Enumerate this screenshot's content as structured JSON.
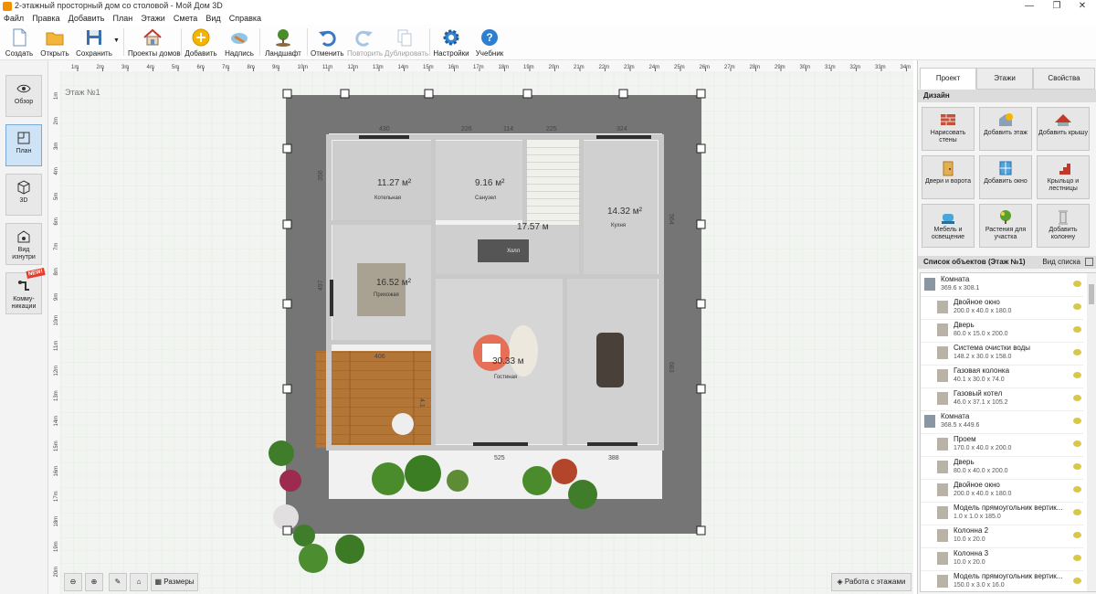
{
  "window": {
    "title": "2-этажный просторный дом со столовой - Мой Дом 3D"
  },
  "menu": [
    "Файл",
    "Правка",
    "Добавить",
    "План",
    "Этажи",
    "Смета",
    "Вид",
    "Справка"
  ],
  "toolbar": {
    "create": "Создать",
    "open": "Открыть",
    "save": "Сохранить",
    "projects": "Проекты домов",
    "add": "Добавить",
    "label": "Надпись",
    "landscape": "Ландшафт",
    "undo": "Отменить",
    "redo": "Повторить",
    "duplicate": "Дублировать",
    "settings": "Настройки",
    "tutorial": "Учебник"
  },
  "left_panel": {
    "overview": "Обзор",
    "plan": "План",
    "view3d": "3D",
    "inside": "Вид изнутри",
    "comms": "Комму-никации",
    "new_badge": "NEW!"
  },
  "ruler_top": [
    "1m",
    "2m",
    "3m",
    "4m",
    "5m",
    "6m",
    "7m",
    "8m",
    "9m",
    "10m",
    "11m",
    "12m",
    "13m",
    "14m",
    "15m",
    "16m",
    "17m",
    "18m",
    "19m",
    "20m",
    "21m",
    "22m",
    "23m",
    "24m",
    "25m",
    "26m",
    "27m",
    "28m",
    "29m",
    "30m",
    "31m",
    "32m",
    "33m",
    "34m"
  ],
  "ruler_left": [
    "1m",
    "2m",
    "3m",
    "4m",
    "5m",
    "6m",
    "7m",
    "8m",
    "9m",
    "10m",
    "11m",
    "12m",
    "13m",
    "14m",
    "15m",
    "16m",
    "17m",
    "18m",
    "19m",
    "20m"
  ],
  "canvas": {
    "floor_label": "Этаж №1",
    "rooms": [
      {
        "area": "11.27 м²",
        "name": "Котельная"
      },
      {
        "area": "9.16 м²",
        "name": "Санузел"
      },
      {
        "area": "17.57 м",
        "name": "Холл"
      },
      {
        "area": "14.32 м²",
        "name": "Кухня"
      },
      {
        "area": "16.52 м²",
        "name": "Прихожая"
      },
      {
        "area": "30.33 м",
        "name": "Гостиная"
      }
    ],
    "dimensions": [
      "430",
      "226",
      "114",
      "225",
      "324",
      "356",
      "564",
      "497",
      "406",
      "525",
      "388",
      "683",
      "4.1"
    ],
    "bottom_buttons": {
      "sizes": "Размеры",
      "floors": "Работа с этажами"
    }
  },
  "right_panel": {
    "tabs": [
      "Проект",
      "Этажи",
      "Свойства"
    ],
    "design_header": "Дизайн",
    "design_buttons": [
      {
        "label": "Нарисовать стены",
        "icon": "brick-wall-icon"
      },
      {
        "label": "Добавить этаж",
        "icon": "add-floor-icon"
      },
      {
        "label": "Добавить крышу",
        "icon": "roof-icon"
      },
      {
        "label": "Двери и ворота",
        "icon": "door-icon"
      },
      {
        "label": "Добавить окно",
        "icon": "window-icon"
      },
      {
        "label": "Крыльцо и лестницы",
        "icon": "stairs-icon"
      },
      {
        "label": "Мебель и освещение",
        "icon": "armchair-icon"
      },
      {
        "label": "Растения для участка",
        "icon": "plants-icon"
      },
      {
        "label": "Добавить колонну",
        "icon": "column-icon"
      }
    ],
    "objects_header": "Список объектов (Этаж №1)",
    "list_view": "Вид списка",
    "objects": [
      {
        "name": "Комната",
        "dims": "369.6 x 308.1",
        "level": 0
      },
      {
        "name": "Двойное окно",
        "dims": "200.0 x 40.0 x 180.0",
        "level": 1
      },
      {
        "name": "Дверь",
        "dims": "80.0 x 15.0 x 200.0",
        "level": 1
      },
      {
        "name": "Система очистки воды",
        "dims": "148.2 x 30.0 x 158.0",
        "level": 1
      },
      {
        "name": "Газовая колонка",
        "dims": "40.1 x 30.0 x 74.0",
        "level": 1
      },
      {
        "name": "Газовый котел",
        "dims": "46.0 x 37.1 x 105.2",
        "level": 1
      },
      {
        "name": "Комната",
        "dims": "368.5 x 449.6",
        "level": 0
      },
      {
        "name": "Проем",
        "dims": "170.0 x 40.0 x 200.0",
        "level": 1
      },
      {
        "name": "Дверь",
        "dims": "80.0 x 40.0 x 200.0",
        "level": 1
      },
      {
        "name": "Двойное окно",
        "dims": "200.0 x 40.0 x 180.0",
        "level": 1
      },
      {
        "name": "Модель прямоугольник вертик...",
        "dims": "1.0 x 1.0 x 185.0",
        "level": 1
      },
      {
        "name": "Колонна 2",
        "dims": "10.0 x 20.0",
        "level": 1
      },
      {
        "name": "Колонна 3",
        "dims": "10.0 x 20.0",
        "level": 1
      },
      {
        "name": "Модель прямоугольник вертик...",
        "dims": "150.0 x 3.0 x 16.0",
        "level": 1
      }
    ]
  }
}
